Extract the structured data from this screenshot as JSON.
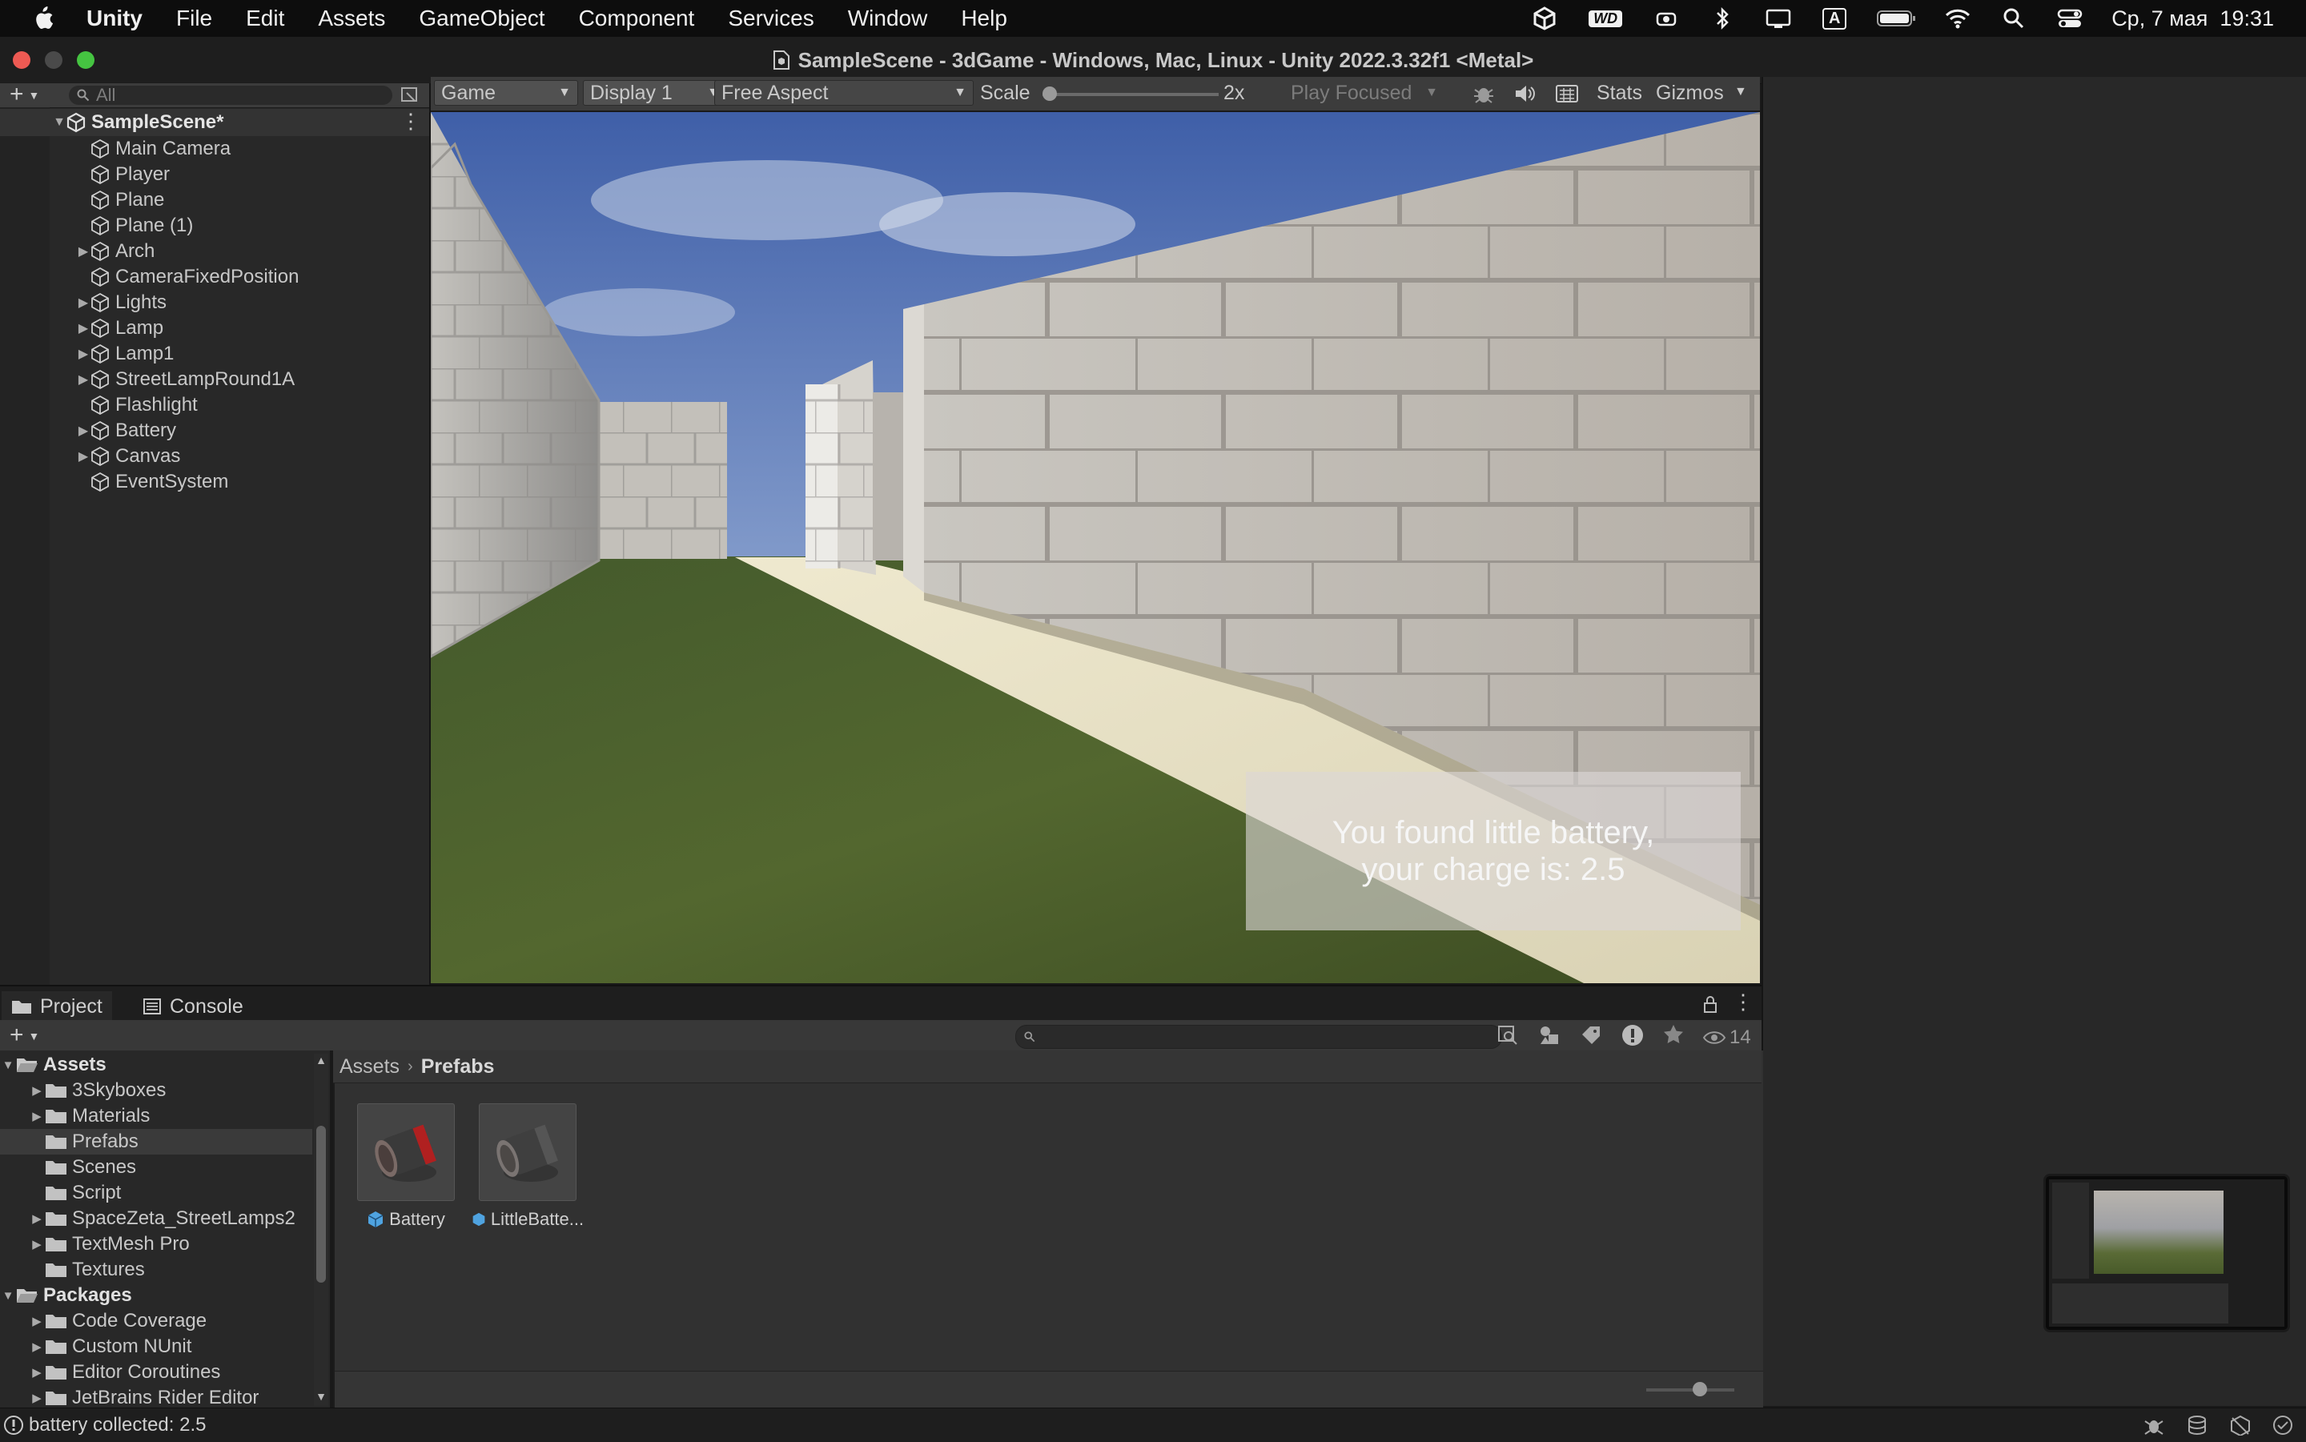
{
  "menubar": {
    "app_name": "Unity",
    "items": [
      "File",
      "Edit",
      "Assets",
      "GameObject",
      "Component",
      "Services",
      "Window",
      "Help"
    ],
    "date_time": "Ср, 7 мая  19:31",
    "wd_badge": "WD",
    "a_badge": "A"
  },
  "window": {
    "title": "SampleScene - 3dGame - Windows, Mac, Linux - Unity 2022.3.32f1 <Metal>"
  },
  "hierarchy": {
    "search_placeholder": "All",
    "scene": "SampleScene*",
    "items": [
      {
        "label": "Main Camera",
        "expandable": false
      },
      {
        "label": "Player",
        "expandable": false
      },
      {
        "label": "Plane",
        "expandable": false
      },
      {
        "label": "Plane (1)",
        "expandable": false
      },
      {
        "label": "Arch",
        "expandable": true
      },
      {
        "label": "CameraFixedPosition",
        "expandable": false
      },
      {
        "label": "Lights",
        "expandable": true
      },
      {
        "label": "Lamp",
        "expandable": true
      },
      {
        "label": "Lamp1",
        "expandable": true
      },
      {
        "label": "StreetLampRound1A",
        "expandable": true
      },
      {
        "label": "Flashlight",
        "expandable": false
      },
      {
        "label": "Battery",
        "expandable": true
      },
      {
        "label": "Canvas",
        "expandable": true
      },
      {
        "label": "EventSystem",
        "expandable": false
      }
    ]
  },
  "game_toolbar": {
    "view": "Game",
    "display": "Display 1",
    "aspect": "Free Aspect",
    "scale_label": "Scale",
    "scale_value": "2x",
    "play_mode": "Play Focused",
    "stats": "Stats",
    "gizmos": "Gizmos"
  },
  "game_view": {
    "message": "You found little battery,\nyour charge is: 2.5"
  },
  "project": {
    "tabs": [
      "Project",
      "Console"
    ],
    "hidden_count": "14",
    "breadcrumb": [
      "Assets",
      "Prefabs"
    ],
    "tree": [
      {
        "label": "Assets",
        "level": 0,
        "bold": true,
        "expanded": true
      },
      {
        "label": "3Skyboxes",
        "level": 1,
        "arrow": true
      },
      {
        "label": "Materials",
        "level": 1,
        "arrow": true
      },
      {
        "label": "Prefabs",
        "level": 1,
        "selected": true
      },
      {
        "label": "Scenes",
        "level": 1
      },
      {
        "label": "Script",
        "level": 1
      },
      {
        "label": "SpaceZeta_StreetLamps2",
        "level": 1,
        "arrow": true
      },
      {
        "label": "TextMesh Pro",
        "level": 1,
        "arrow": true
      },
      {
        "label": "Textures",
        "level": 1
      },
      {
        "label": "Packages",
        "level": 0,
        "bold": true,
        "expanded": true
      },
      {
        "label": "Code Coverage",
        "level": 1,
        "arrow": true
      },
      {
        "label": "Custom NUnit",
        "level": 1,
        "arrow": true
      },
      {
        "label": "Editor Coroutines",
        "level": 1,
        "arrow": true
      },
      {
        "label": "JetBrains Rider Editor",
        "level": 1,
        "arrow": true
      }
    ],
    "assets": [
      "Battery",
      "LittleBatte..."
    ]
  },
  "status": {
    "message": "battery collected: 2.5"
  },
  "colors": {
    "accent": "#2c5d87",
    "panel": "#282828",
    "toolbar": "#3c3c3c"
  }
}
